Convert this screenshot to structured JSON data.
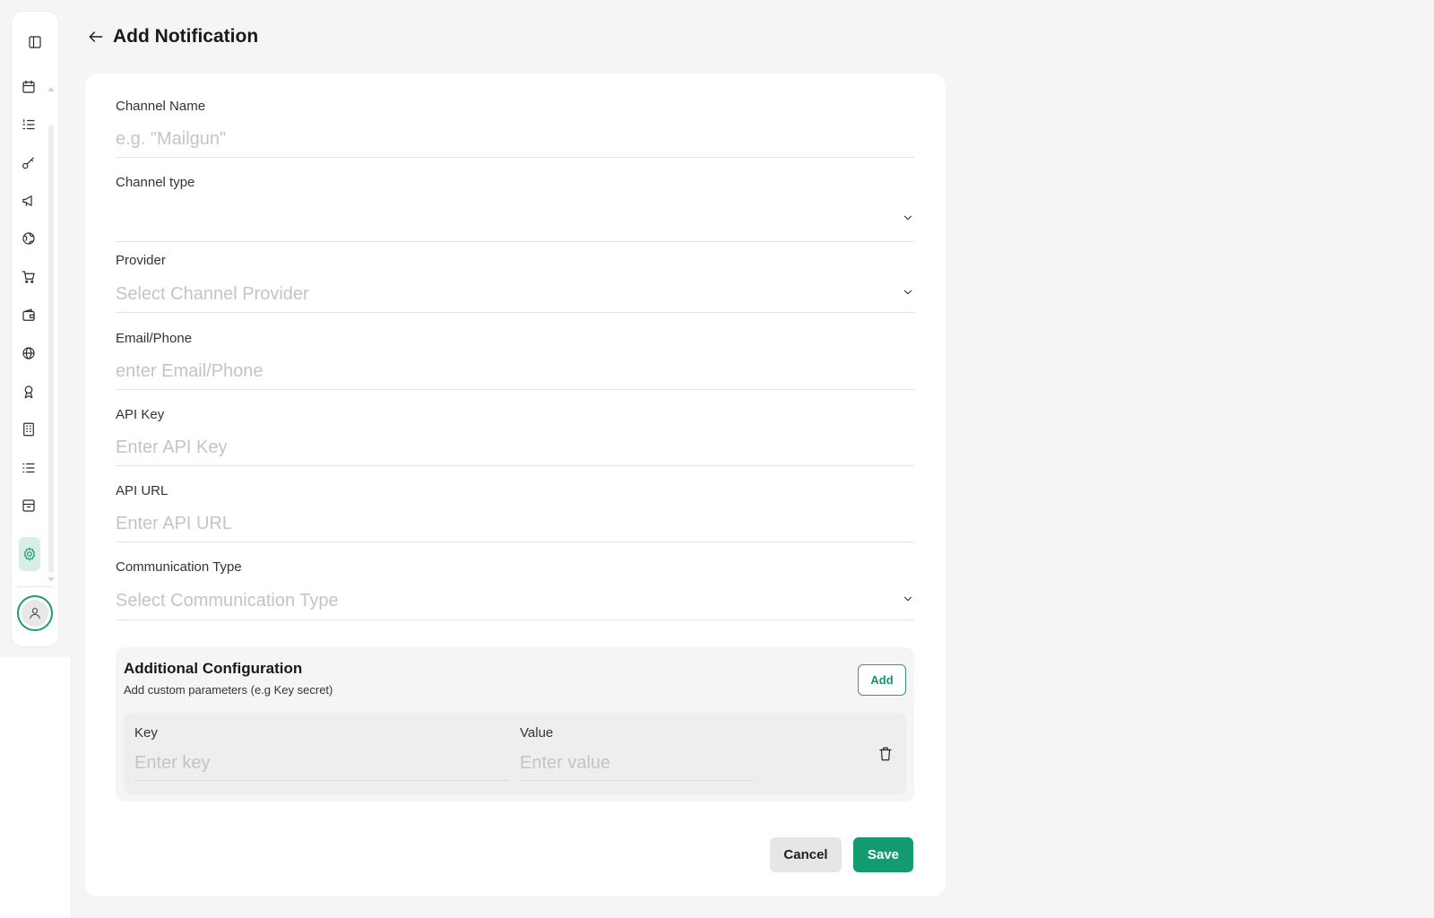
{
  "header": {
    "back_icon": "arrow-left-icon",
    "title": "Add Notification"
  },
  "sidebar": {
    "items": [
      {
        "icon": "sidebar-toggle-icon",
        "active": false
      },
      {
        "icon": "calendar-icon",
        "active": false
      },
      {
        "icon": "list-ordered-icon",
        "active": false
      },
      {
        "icon": "key-icon",
        "active": false
      },
      {
        "icon": "megaphone-icon",
        "active": false
      },
      {
        "icon": "globe-network-icon",
        "active": false
      },
      {
        "icon": "cart-icon",
        "active": false
      },
      {
        "icon": "wallet-icon",
        "active": false
      },
      {
        "icon": "globe-icon",
        "active": false
      },
      {
        "icon": "award-icon",
        "active": false
      },
      {
        "icon": "building-icon",
        "active": false
      },
      {
        "icon": "list-icon",
        "active": false
      },
      {
        "icon": "archive-icon",
        "active": false
      },
      {
        "icon": "settings-icon",
        "active": true
      }
    ],
    "avatar_icon": "user-icon",
    "accent_color": "#1a9b73"
  },
  "form": {
    "channel_name": {
      "label": "Channel Name",
      "placeholder": "e.g. \"Mailgun\""
    },
    "channel_type": {
      "label": "Channel type",
      "value": ""
    },
    "provider": {
      "label": "Provider",
      "placeholder": "Select Channel Provider"
    },
    "email_phone": {
      "label": "Email/Phone",
      "placeholder": "enter Email/Phone"
    },
    "api_key": {
      "label": "API Key",
      "placeholder": "Enter API Key"
    },
    "api_url": {
      "label": "API URL",
      "placeholder": "Enter API URL"
    },
    "communication_type": {
      "label": "Communication Type",
      "placeholder": "Select Communication Type"
    }
  },
  "additional_config": {
    "title": "Additional Configuration",
    "subtitle": "Add custom parameters (e.g Key secret)",
    "add_label": "Add",
    "rows": [
      {
        "key_label": "Key",
        "key_placeholder": "Enter key",
        "value_label": "Value",
        "value_placeholder": "Enter value",
        "delete_icon": "trash-icon"
      }
    ]
  },
  "actions": {
    "cancel_label": "Cancel",
    "save_label": "Save",
    "save_color": "#139a70"
  }
}
